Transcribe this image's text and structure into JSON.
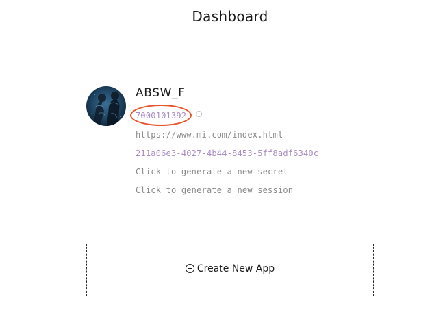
{
  "header": {
    "title": "Dashboard"
  },
  "app": {
    "name": "ABSW_F",
    "app_id": "7000101392",
    "redirect_url": "https://www.mi.com/index.html",
    "app_key": "211a06e3-4027-4b44-8453-5ff8adf6340c",
    "generate_secret_label": "Click to generate a new secret",
    "generate_session_label": "Click to generate a new session"
  },
  "create_app": {
    "label": "Create New App",
    "icon": "plus-circle-icon"
  },
  "annotation": {
    "color": "#e8542c"
  },
  "colors": {
    "id_text": "#a98cc4",
    "muted_text": "#8a8a8a"
  }
}
